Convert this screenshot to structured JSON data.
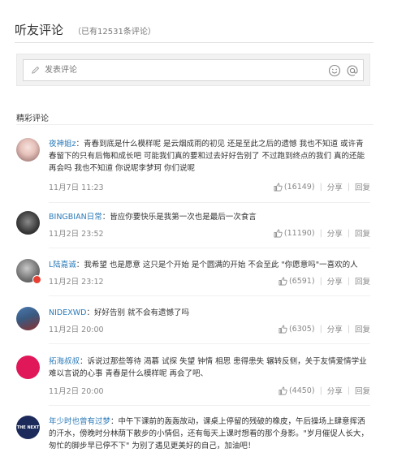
{
  "header": {
    "title": "听友评论",
    "count": "（已有12531条评论）"
  },
  "composer": {
    "placeholder": "发表评论"
  },
  "section": {
    "title": "精彩评论"
  },
  "comments": [
    {
      "user": "夜神姐z",
      "text": "青春到底是什么模样呢 是云烟成雨的初见 还是至此之后的遗憾 我也不知道 或许青春留下的只有后悔和成长吧 可能我们真的要和过去好好告别了 不过跑到终点的我们 真的还能再会吗 我也不知道 你说呢李梦珂 你们说呢",
      "date": "11月7日 11:23",
      "likes": "(16149)",
      "share": "分享",
      "reply": "回复"
    },
    {
      "user": "BINGBIAN日常",
      "text": "皆应你要快乐是我第一次也是最后一次食言",
      "date": "11月2日 23:52",
      "likes": "(11190)",
      "share": "分享",
      "reply": "回复"
    },
    {
      "user": "L陆嘉诚",
      "text": "我希望 也是愿意 这只是个开始 是个圆满的开始 不会至此 \"你愿意吗\"一喜欢的人",
      "date": "11月2日 23:12",
      "likes": "(6591)",
      "share": "分享",
      "reply": "回复"
    },
    {
      "user": "NIDEXWD",
      "text": "好好告别 就不会有遗憾了吗",
      "date": "11月2日 20:00",
      "likes": "(6305)",
      "share": "分享",
      "reply": "回复"
    },
    {
      "user": "拓海叔叔",
      "text": "诉说过那些等待 渴慕 试探 失望 钟情 相思 患得患失 辗转反侧，关于友情爱情学业难以言说的心事 青春是什么模样呢 再会了吧、",
      "date": "11月2日 20:00",
      "likes": "(4450)",
      "share": "分享",
      "reply": "回复"
    },
    {
      "user": "年少时也曾有过梦",
      "text": "中午下课前的轰轰故动，课桌上停留的残破的橡皮，午后操场上肆意挥洒的汗水，傍晚时分林荫下散步的小情侣，还有每天上课时想看的那个身影。\"岁月催促人长大，匆忙的脚步早已停不下\" 为别了遇见更美好的自己，加油吧！",
      "avatar_text": "THE NEXT",
      "date": "",
      "likes": "",
      "share": "",
      "reply": ""
    }
  ],
  "colors": {
    "username": "#2a7ab8",
    "meta": "#888888"
  }
}
